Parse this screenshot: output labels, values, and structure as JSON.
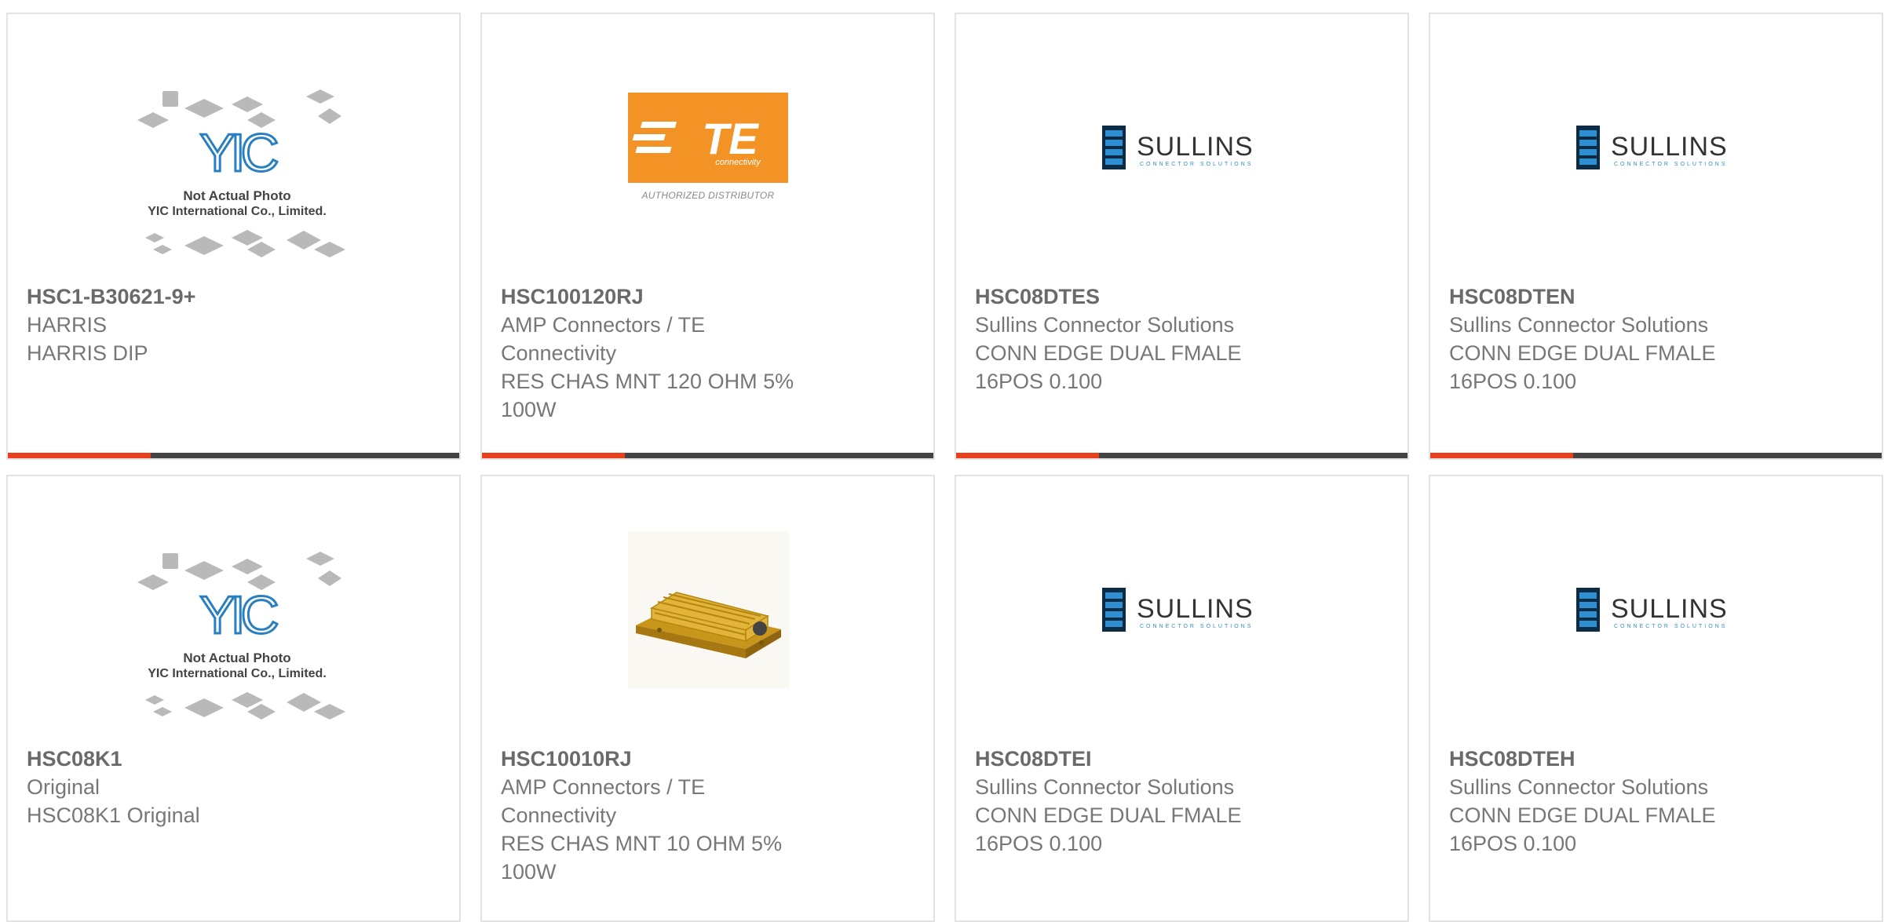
{
  "accent_color": "#e8401c",
  "bar_color": "#444444",
  "products": [
    {
      "part_number": "HSC1-B30621-9+",
      "manufacturer": "HARRIS",
      "description": "HARRIS DIP",
      "image": "yic-placeholder",
      "image_text_1": "Not Actual Photo",
      "image_text_2": "YIC International Co., Limited."
    },
    {
      "part_number": "HSC100120RJ",
      "manufacturer": "AMP Connectors / TE Connectivity",
      "description": "RES CHAS MNT 120 OHM 5% 100W",
      "image": "te-logo",
      "logo_text": "TE",
      "logo_sub": "connectivity",
      "logo_caption": "AUTHORIZED DISTRIBUTOR"
    },
    {
      "part_number": "HSC08DTES",
      "manufacturer": "Sullins Connector Solutions",
      "description": "CONN EDGE DUAL FMALE 16POS 0.100",
      "image": "sullins-logo",
      "logo_text": "SULLINS",
      "logo_sub": "CONNECTOR SOLUTIONS"
    },
    {
      "part_number": "HSC08DTEN",
      "manufacturer": "Sullins Connector Solutions",
      "description": "CONN EDGE DUAL FMALE 16POS 0.100",
      "image": "sullins-logo",
      "logo_text": "SULLINS",
      "logo_sub": "CONNECTOR SOLUTIONS"
    },
    {
      "part_number": "HSC08K1",
      "manufacturer": "Original",
      "description": "HSC08K1 Original",
      "image": "yic-placeholder",
      "image_text_1": "Not Actual Photo",
      "image_text_2": "YIC International Co., Limited."
    },
    {
      "part_number": "HSC10010RJ",
      "manufacturer": "AMP Connectors / TE Connectivity",
      "description": "RES CHAS MNT 10 OHM 5% 100W",
      "image": "resistor-photo"
    },
    {
      "part_number": "HSC08DTEI",
      "manufacturer": "Sullins Connector Solutions",
      "description": "CONN EDGE DUAL FMALE 16POS 0.100",
      "image": "sullins-logo",
      "logo_text": "SULLINS",
      "logo_sub": "CONNECTOR SOLUTIONS"
    },
    {
      "part_number": "HSC08DTEH",
      "manufacturer": "Sullins Connector Solutions",
      "description": "CONN EDGE DUAL FMALE 16POS 0.100",
      "image": "sullins-logo",
      "logo_text": "SULLINS",
      "logo_sub": "CONNECTOR SOLUTIONS"
    }
  ]
}
